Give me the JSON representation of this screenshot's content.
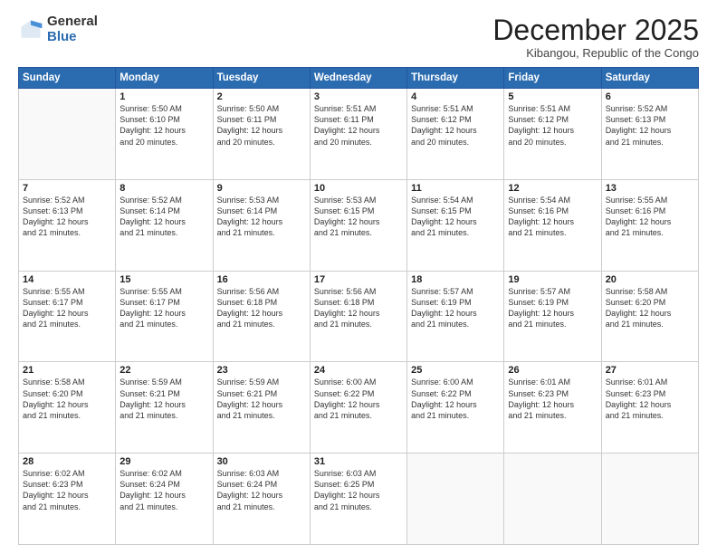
{
  "logo": {
    "general": "General",
    "blue": "Blue"
  },
  "header": {
    "month": "December 2025",
    "location": "Kibangou, Republic of the Congo"
  },
  "days": [
    "Sunday",
    "Monday",
    "Tuesday",
    "Wednesday",
    "Thursday",
    "Friday",
    "Saturday"
  ],
  "weeks": [
    [
      {
        "day": "",
        "info": ""
      },
      {
        "day": "1",
        "info": "Sunrise: 5:50 AM\nSunset: 6:10 PM\nDaylight: 12 hours\nand 20 minutes."
      },
      {
        "day": "2",
        "info": "Sunrise: 5:50 AM\nSunset: 6:11 PM\nDaylight: 12 hours\nand 20 minutes."
      },
      {
        "day": "3",
        "info": "Sunrise: 5:51 AM\nSunset: 6:11 PM\nDaylight: 12 hours\nand 20 minutes."
      },
      {
        "day": "4",
        "info": "Sunrise: 5:51 AM\nSunset: 6:12 PM\nDaylight: 12 hours\nand 20 minutes."
      },
      {
        "day": "5",
        "info": "Sunrise: 5:51 AM\nSunset: 6:12 PM\nDaylight: 12 hours\nand 20 minutes."
      },
      {
        "day": "6",
        "info": "Sunrise: 5:52 AM\nSunset: 6:13 PM\nDaylight: 12 hours\nand 21 minutes."
      }
    ],
    [
      {
        "day": "7",
        "info": "Sunrise: 5:52 AM\nSunset: 6:13 PM\nDaylight: 12 hours\nand 21 minutes."
      },
      {
        "day": "8",
        "info": "Sunrise: 5:52 AM\nSunset: 6:14 PM\nDaylight: 12 hours\nand 21 minutes."
      },
      {
        "day": "9",
        "info": "Sunrise: 5:53 AM\nSunset: 6:14 PM\nDaylight: 12 hours\nand 21 minutes."
      },
      {
        "day": "10",
        "info": "Sunrise: 5:53 AM\nSunset: 6:15 PM\nDaylight: 12 hours\nand 21 minutes."
      },
      {
        "day": "11",
        "info": "Sunrise: 5:54 AM\nSunset: 6:15 PM\nDaylight: 12 hours\nand 21 minutes."
      },
      {
        "day": "12",
        "info": "Sunrise: 5:54 AM\nSunset: 6:16 PM\nDaylight: 12 hours\nand 21 minutes."
      },
      {
        "day": "13",
        "info": "Sunrise: 5:55 AM\nSunset: 6:16 PM\nDaylight: 12 hours\nand 21 minutes."
      }
    ],
    [
      {
        "day": "14",
        "info": "Sunrise: 5:55 AM\nSunset: 6:17 PM\nDaylight: 12 hours\nand 21 minutes."
      },
      {
        "day": "15",
        "info": "Sunrise: 5:55 AM\nSunset: 6:17 PM\nDaylight: 12 hours\nand 21 minutes."
      },
      {
        "day": "16",
        "info": "Sunrise: 5:56 AM\nSunset: 6:18 PM\nDaylight: 12 hours\nand 21 minutes."
      },
      {
        "day": "17",
        "info": "Sunrise: 5:56 AM\nSunset: 6:18 PM\nDaylight: 12 hours\nand 21 minutes."
      },
      {
        "day": "18",
        "info": "Sunrise: 5:57 AM\nSunset: 6:19 PM\nDaylight: 12 hours\nand 21 minutes."
      },
      {
        "day": "19",
        "info": "Sunrise: 5:57 AM\nSunset: 6:19 PM\nDaylight: 12 hours\nand 21 minutes."
      },
      {
        "day": "20",
        "info": "Sunrise: 5:58 AM\nSunset: 6:20 PM\nDaylight: 12 hours\nand 21 minutes."
      }
    ],
    [
      {
        "day": "21",
        "info": "Sunrise: 5:58 AM\nSunset: 6:20 PM\nDaylight: 12 hours\nand 21 minutes."
      },
      {
        "day": "22",
        "info": "Sunrise: 5:59 AM\nSunset: 6:21 PM\nDaylight: 12 hours\nand 21 minutes."
      },
      {
        "day": "23",
        "info": "Sunrise: 5:59 AM\nSunset: 6:21 PM\nDaylight: 12 hours\nand 21 minutes."
      },
      {
        "day": "24",
        "info": "Sunrise: 6:00 AM\nSunset: 6:22 PM\nDaylight: 12 hours\nand 21 minutes."
      },
      {
        "day": "25",
        "info": "Sunrise: 6:00 AM\nSunset: 6:22 PM\nDaylight: 12 hours\nand 21 minutes."
      },
      {
        "day": "26",
        "info": "Sunrise: 6:01 AM\nSunset: 6:23 PM\nDaylight: 12 hours\nand 21 minutes."
      },
      {
        "day": "27",
        "info": "Sunrise: 6:01 AM\nSunset: 6:23 PM\nDaylight: 12 hours\nand 21 minutes."
      }
    ],
    [
      {
        "day": "28",
        "info": "Sunrise: 6:02 AM\nSunset: 6:23 PM\nDaylight: 12 hours\nand 21 minutes."
      },
      {
        "day": "29",
        "info": "Sunrise: 6:02 AM\nSunset: 6:24 PM\nDaylight: 12 hours\nand 21 minutes."
      },
      {
        "day": "30",
        "info": "Sunrise: 6:03 AM\nSunset: 6:24 PM\nDaylight: 12 hours\nand 21 minutes."
      },
      {
        "day": "31",
        "info": "Sunrise: 6:03 AM\nSunset: 6:25 PM\nDaylight: 12 hours\nand 21 minutes."
      },
      {
        "day": "",
        "info": ""
      },
      {
        "day": "",
        "info": ""
      },
      {
        "day": "",
        "info": ""
      }
    ]
  ]
}
